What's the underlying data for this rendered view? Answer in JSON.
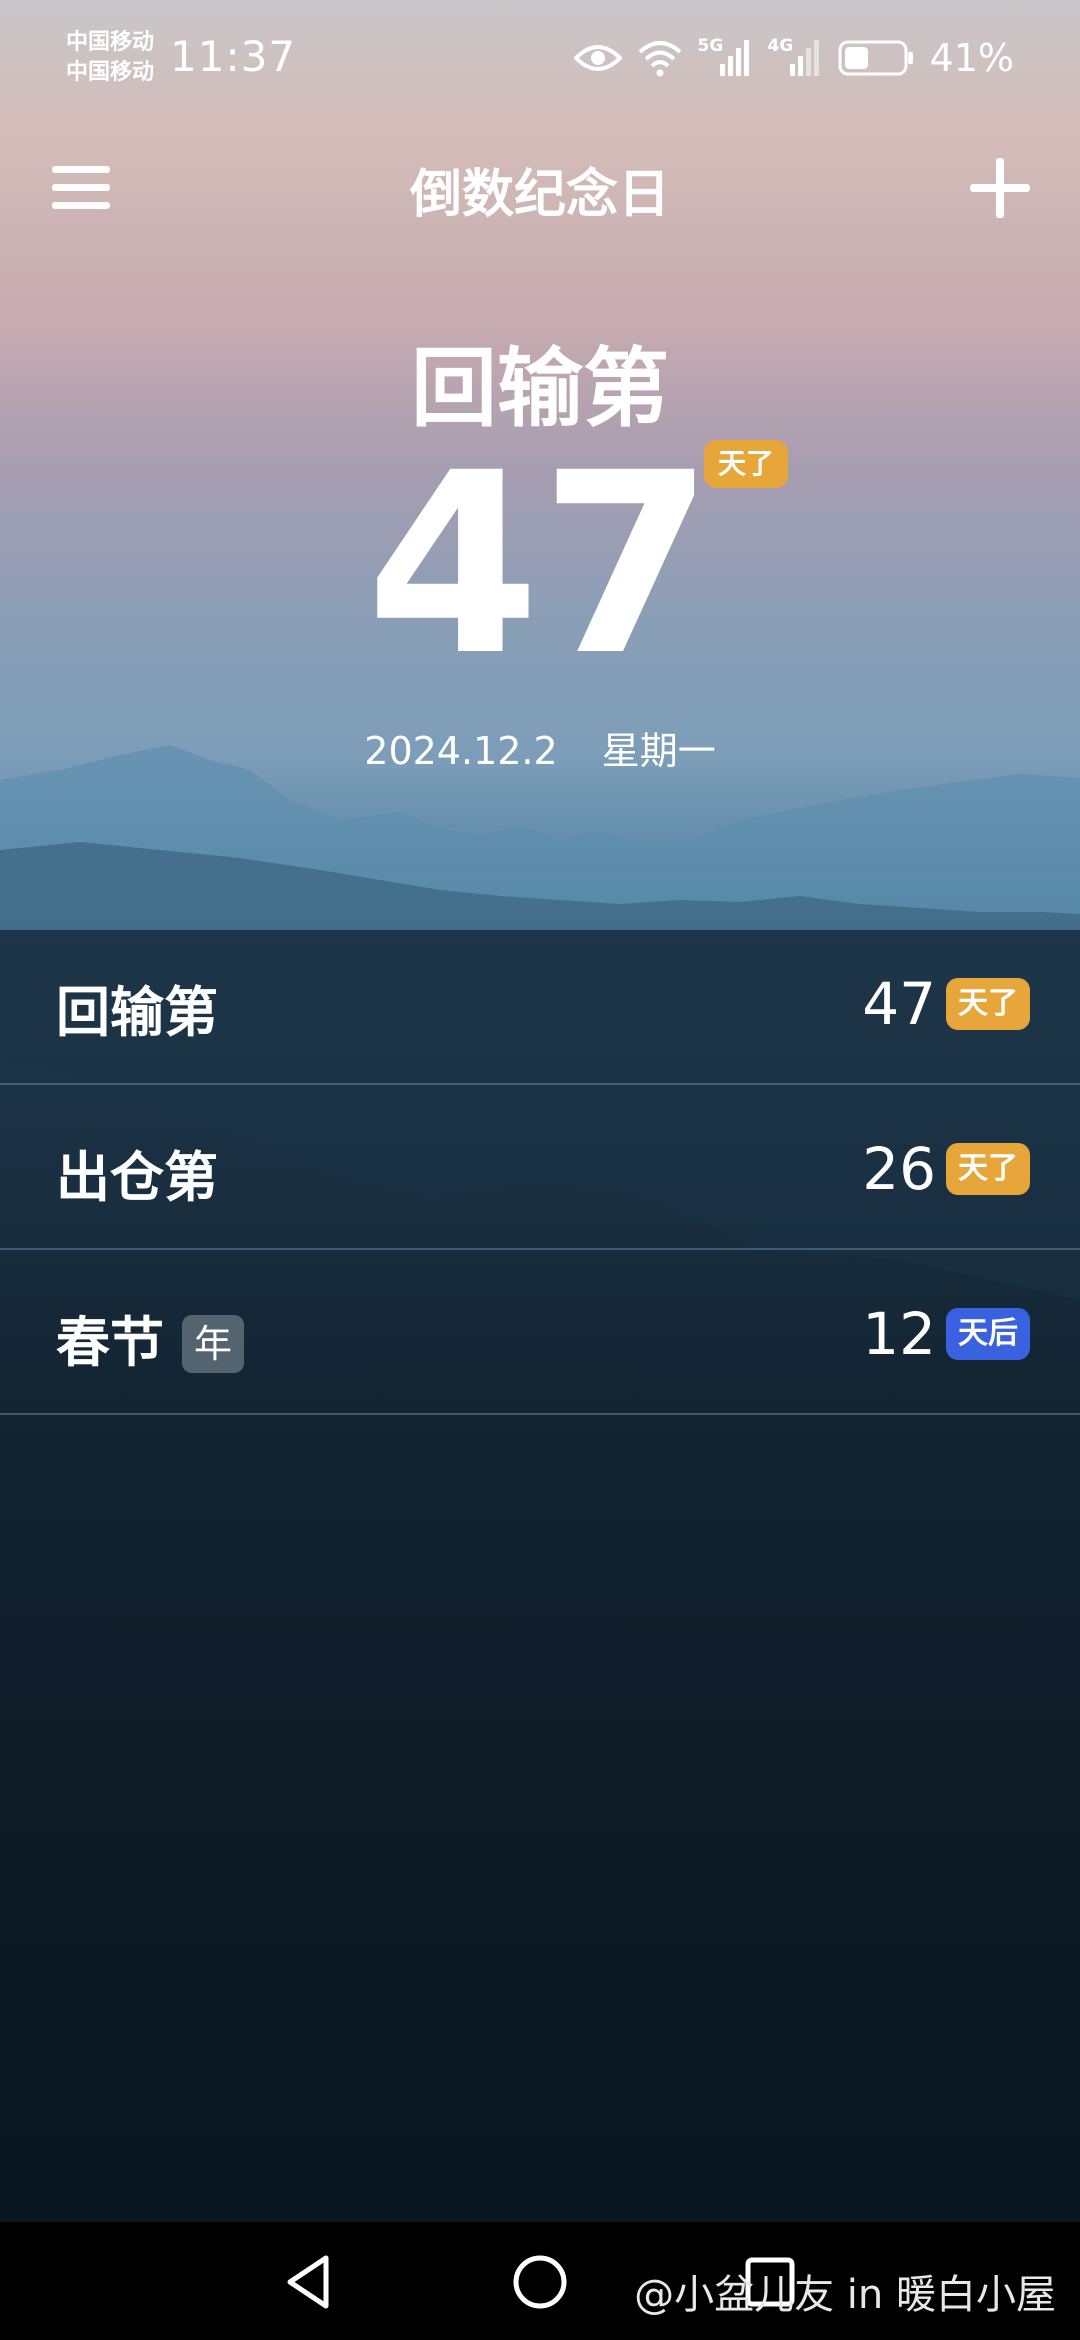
{
  "status_bar": {
    "carrier_1": "中国移动",
    "carrier_2": "中国移动",
    "time": "11:37",
    "network_1": "5G",
    "network_2": "4G",
    "battery_percent": "41%",
    "battery_level": 0.41
  },
  "header": {
    "title": "倒数纪念日"
  },
  "hero": {
    "name": "回输第",
    "days": "47",
    "badge": "天了",
    "date": "2024.12.2",
    "weekday": "星期一",
    "badge_color": "#e6a63a"
  },
  "list": [
    {
      "name": "回输第",
      "tag": "",
      "days": "47",
      "badge": "天了",
      "badge_color": "#e6a63a"
    },
    {
      "name": "出仓第",
      "tag": "",
      "days": "26",
      "badge": "天了",
      "badge_color": "#e6a63a"
    },
    {
      "name": "春节",
      "tag": "年",
      "days": "12",
      "badge": "天后",
      "badge_color": "#3a62e0"
    }
  ],
  "watermark": "@小盆儿友 in 暖白小屋",
  "icons": {
    "menu": "menu-icon",
    "add": "plus-icon",
    "back": "back-triangle-icon",
    "home": "home-circle-icon",
    "recents": "recents-square-icon"
  }
}
